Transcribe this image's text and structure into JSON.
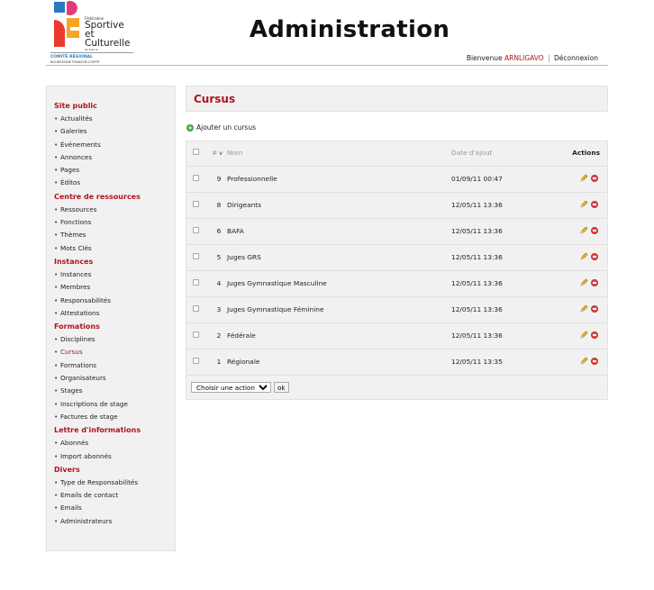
{
  "header": {
    "logo": {
      "line1": "Fédération",
      "line2": "Sportive",
      "line3": "et Culturelle",
      "line4": "de France",
      "comite": "COMITÉ RÉGIONAL",
      "region": "BOURGOGNE FRANCHE-COMTÉ"
    },
    "title": "Administration",
    "welcome": "Bienvenue",
    "username": "ARNLIGAVO",
    "separator": "|",
    "logout": "Déconnexion"
  },
  "sidebar": {
    "sections": [
      {
        "title": "Site public",
        "items": [
          "Actualités",
          "Galeries",
          "Événements",
          "Annonces",
          "Pages",
          "Éditos"
        ]
      },
      {
        "title": "Centre de ressources",
        "items": [
          "Ressources",
          "Fonctions",
          "Thèmes",
          "Mots Clés"
        ]
      },
      {
        "title": "Instances",
        "items": [
          "Instances",
          "Membres",
          "Responsabilités",
          "Attestations"
        ]
      },
      {
        "title": "Formations",
        "items": [
          "Disciplines",
          "Cursus",
          "Formations",
          "Organisateurs",
          "Stages",
          "Inscriptions de stage",
          "Factures de stage"
        ]
      },
      {
        "title": "Lettre d'informations",
        "items": [
          "Abonnés",
          "Import abonnés"
        ]
      },
      {
        "title": "Divers",
        "items": [
          "Type de Responsabilités",
          "Emails de contact",
          "Emails",
          "Administrateurs"
        ]
      }
    ]
  },
  "main": {
    "title": "Cursus",
    "add_label": "Ajouter un cursus",
    "table": {
      "columns": {
        "id": "#",
        "sort_arrow": "v",
        "name": "Nom",
        "date": "Date d'ajout",
        "actions": "Actions"
      },
      "rows": [
        {
          "id": "9",
          "name": "Professionnelle",
          "date": "01/09/11 00:47"
        },
        {
          "id": "8",
          "name": "Dirigeants",
          "date": "12/05/11 13:36"
        },
        {
          "id": "6",
          "name": "BAFA",
          "date": "12/05/11 13:36"
        },
        {
          "id": "5",
          "name": "Juges GRS",
          "date": "12/05/11 13:36"
        },
        {
          "id": "4",
          "name": "Juges Gymnastique Masculine",
          "date": "12/05/11 13:36"
        },
        {
          "id": "3",
          "name": "Juges Gymnastique Féminine",
          "date": "12/05/11 13:36"
        },
        {
          "id": "2",
          "name": "Fédérale",
          "date": "12/05/11 13:36"
        },
        {
          "id": "1",
          "name": "Régionale",
          "date": "12/05/11 13:35"
        }
      ]
    },
    "bulk": {
      "select_label": "Choisir une action",
      "ok_label": "ok"
    }
  },
  "colors": {
    "accent": "#b0141e",
    "panel": "#f1f1f1",
    "add_icon": "#3ea63e",
    "delete_icon": "#e04848"
  }
}
